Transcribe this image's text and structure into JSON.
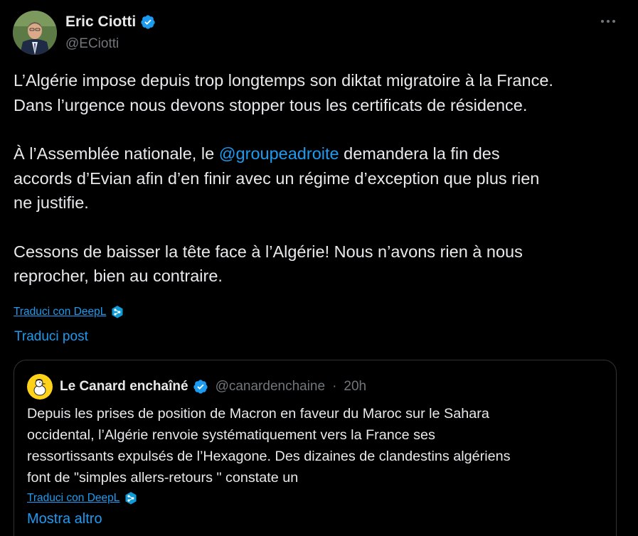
{
  "tweet": {
    "author_name": "Eric Ciotti",
    "author_handle": "@ECiotti",
    "para1_line1": "L’Algérie impose depuis trop longtemps son diktat migratoire à la France.",
    "para1_line2": "Dans l’urgence nous devons stopper tous les certificats de résidence.",
    "para2_before": "À l’Assemblée nationale, le ",
    "para2_mention": "@groupeadroite",
    "para2_after_line1": " demandera la fin des",
    "para2_line2": "accords d’Evian afin d’en finir avec un régime d’exception que plus rien",
    "para2_line3": "ne justifie.",
    "para3_line1": "Cessons de baisser la tête face à l’Algérie! Nous n’avons rien à nous",
    "para3_line2": "reprocher, bien au contraire.",
    "deepl_label": "Traduci con DeepL",
    "translate_post_label": "Traduci post"
  },
  "quote": {
    "author_name": "Le Canard enchaîné",
    "author_handle": "@canardenchaine",
    "separator": "·",
    "time": "20h",
    "line1": "Depuis les prises de position de Macron en faveur du Maroc sur le Sahara",
    "line2": "occidental, l’Algérie renvoie systématiquement vers la France ses",
    "line3": "ressortissants expulsés de l’Hexagone. Des dizaines de clandestins algériens",
    "line4": "font de \"simples allers-retours \" constate un",
    "deepl_label": "Traduci con DeepL",
    "show_more_label": "Mostra altro"
  },
  "icons": {
    "verified": "verified-badge-icon",
    "more": "more-horizontal-icon",
    "deepl": "deepl-icon"
  },
  "colors": {
    "background": "#000000",
    "text": "#e7e9ea",
    "muted": "#71767b",
    "link": "#1d9bf0",
    "border": "#2f3336",
    "verified": "#1d9bf0",
    "canard_avatar": "#ffd21a"
  }
}
